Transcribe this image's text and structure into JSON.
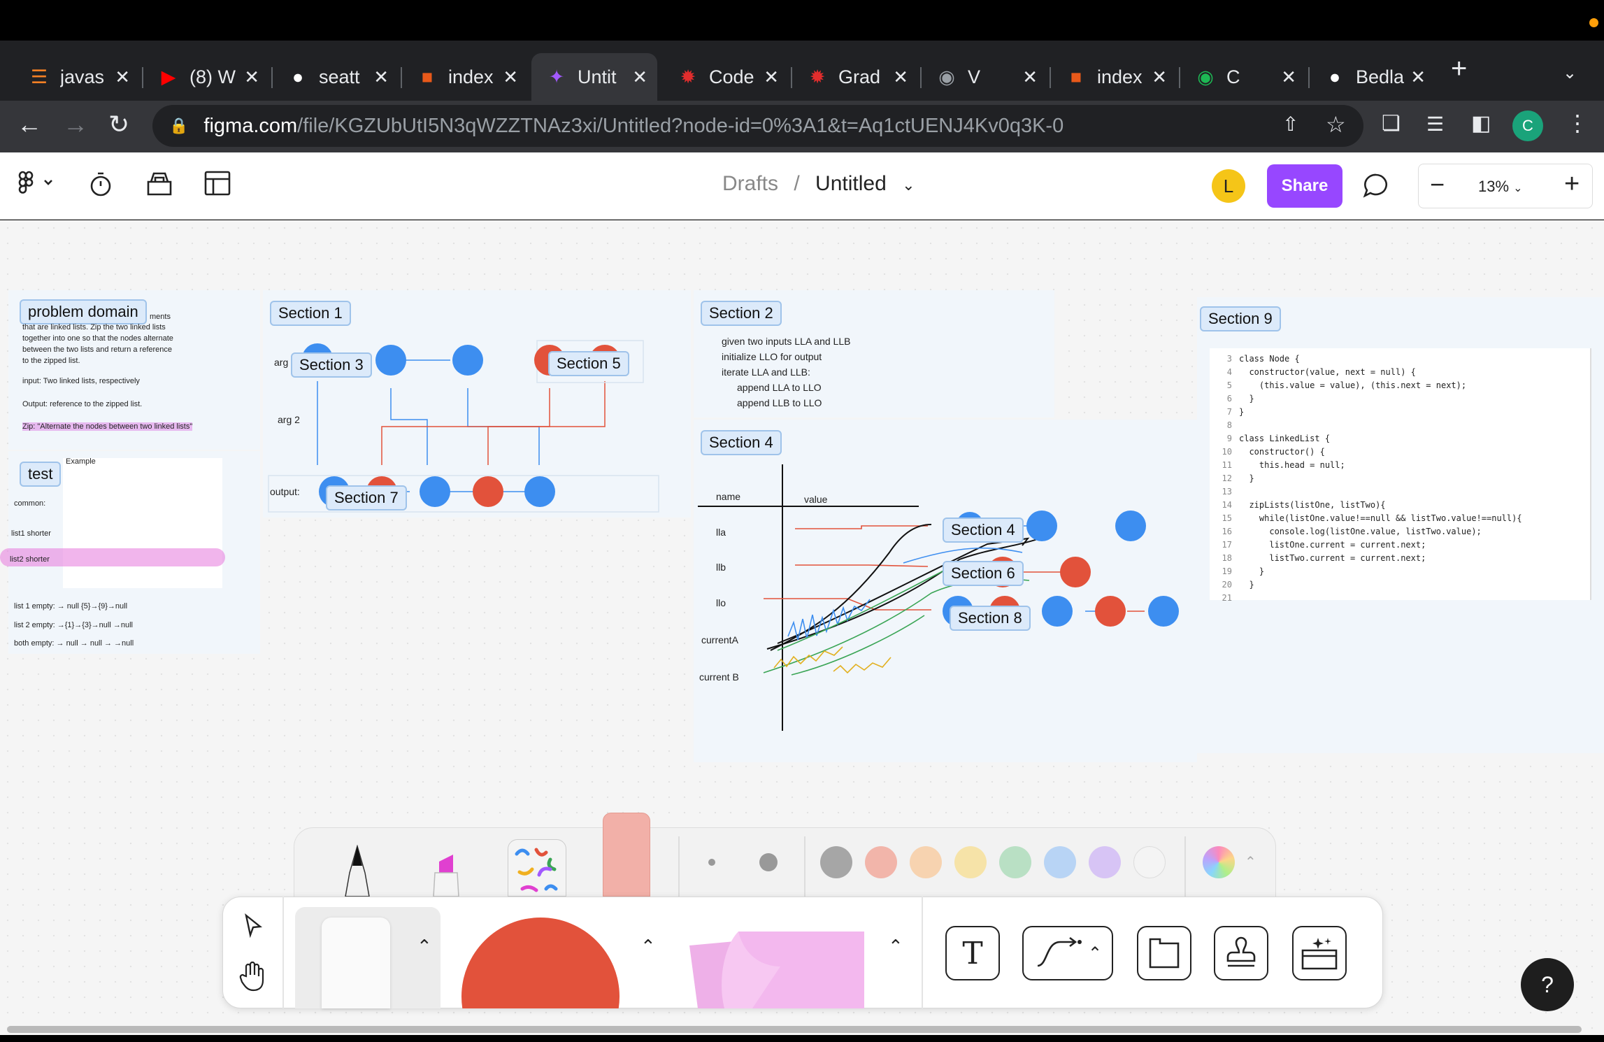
{
  "browser": {
    "tabs": [
      {
        "title": "javas",
        "icon": "stack-icon",
        "color": "#f48024",
        "active": false
      },
      {
        "title": "(8) W",
        "icon": "youtube-icon",
        "color": "#ff0000",
        "active": false
      },
      {
        "title": "seatt",
        "icon": "github-icon",
        "color": "#ffffff",
        "active": false
      },
      {
        "title": "index",
        "icon": "codefellows-icon",
        "color": "#e8591a",
        "active": false
      },
      {
        "title": "Untit",
        "icon": "figma-icon",
        "color": "#a259ff",
        "active": true
      },
      {
        "title": "Code",
        "icon": "canvas-icon",
        "color": "#e22d2d",
        "active": false
      },
      {
        "title": "Grad",
        "icon": "canvas-icon",
        "color": "#e22d2d",
        "active": false
      },
      {
        "title": "V",
        "icon": "globe-icon",
        "color": "#9aa0a6",
        "active": false
      },
      {
        "title": "index",
        "icon": "codefellows-icon",
        "color": "#e8591a",
        "active": false
      },
      {
        "title": "C",
        "icon": "spotify-icon",
        "color": "#1db954",
        "active": false
      },
      {
        "title": "Bedla",
        "icon": "github-icon",
        "color": "#ffffff",
        "active": false
      }
    ],
    "url_host": "figma.com",
    "url_path": "/file/KGZUbUtI5N3qWZZTNAz3xi/Untitled?node-id=0%3A1&t=Aq1ctUENJ4Kv0q3K-0",
    "profile_initial": "C"
  },
  "figma": {
    "breadcrumb_parent": "Drafts",
    "breadcrumb_sep": "/",
    "file_name": "Untitled",
    "user_initial": "L",
    "share_label": "Share",
    "zoom_level": "13%"
  },
  "canvas": {
    "sections": {
      "problem_domain": "problem domain",
      "test": "test",
      "s1": "Section 1",
      "s2": "Section 2",
      "s3": "Section 3",
      "s4a": "Section 4",
      "s4b": "Section 4",
      "s5": "Section 5",
      "s6": "Section 6",
      "s7": "Section 7",
      "s8": "Section 8",
      "s9": "Section 9"
    },
    "problem": {
      "line0": "ments",
      "line1": "that are linked lists. Zip the two linked lists",
      "line2": "together into one so that the nodes alternate",
      "line3": "between the two lists and return a reference",
      "line4": "to the zipped list.",
      "input": "input: Two linked lists, respectively",
      "output": "Output: reference to the zipped list.",
      "zip": "Zip: \"Alternate the nodes between two linked lists\""
    },
    "test": {
      "example": "Example",
      "common": "common:",
      "list1_shorter": "list1 shorter",
      "list2_shorter": "list2 shorter",
      "empty1": "list 1 empty: → null        {5}→{9}→null",
      "empty2": "list 2 empty: →{1}→{3}→null      →null",
      "empty_both": "both empty: → null → null  → →null"
    },
    "s1": {
      "arg1": "arg",
      "arg2": "arg 2",
      "output": "output:"
    },
    "s2": {
      "l1": "given two inputs LLA and LLB",
      "l2": "initialize LLO for output",
      "l3": "iterate LLA and LLB:",
      "l4": "append LLA to LLO",
      "l5": "append LLB to LLO"
    },
    "s4": {
      "name": "name",
      "value": "value",
      "lla": "lla",
      "llb": "llb",
      "llo": "llo",
      "currentA": "currentA",
      "currentB": "current B"
    },
    "code": [
      {
        "n": "3",
        "t": "class Node {"
      },
      {
        "n": "4",
        "t": "  constructor(value, next = null) {"
      },
      {
        "n": "5",
        "t": "    (this.value = value), (this.next = next);"
      },
      {
        "n": "6",
        "t": "  }"
      },
      {
        "n": "7",
        "t": "}"
      },
      {
        "n": "8",
        "t": ""
      },
      {
        "n": "9",
        "t": "class LinkedList {"
      },
      {
        "n": "10",
        "t": "  constructor() {"
      },
      {
        "n": "11",
        "t": "    this.head = null;"
      },
      {
        "n": "12",
        "t": "  }"
      },
      {
        "n": "13",
        "t": ""
      },
      {
        "n": "14",
        "t": "  zipLists(listOne, listTwo){"
      },
      {
        "n": "15",
        "t": "    while(listOne.value!==null && listTwo.value!==null){"
      },
      {
        "n": "16",
        "t": "      console.log(listOne.value, listTwo.value);"
      },
      {
        "n": "17",
        "t": "      listOne.current = current.next;"
      },
      {
        "n": "18",
        "t": "      listTwo.current = current.next;"
      },
      {
        "n": "19",
        "t": "    }"
      },
      {
        "n": "20",
        "t": "  }"
      },
      {
        "n": "21",
        "t": ""
      }
    ]
  },
  "tray_colors": [
    "#a6a6a6",
    "#f2b5aa",
    "#f7d3b0",
    "#f6e3a8",
    "#b9e0c4",
    "#b8d4f5",
    "#d7c4f5",
    "#f4f4f4"
  ],
  "colors": {
    "node_blue": "#3d8ef0",
    "node_red": "#e2523b",
    "section_label_bg": "#dceafa",
    "share": "#9747ff"
  },
  "help_label": "?"
}
